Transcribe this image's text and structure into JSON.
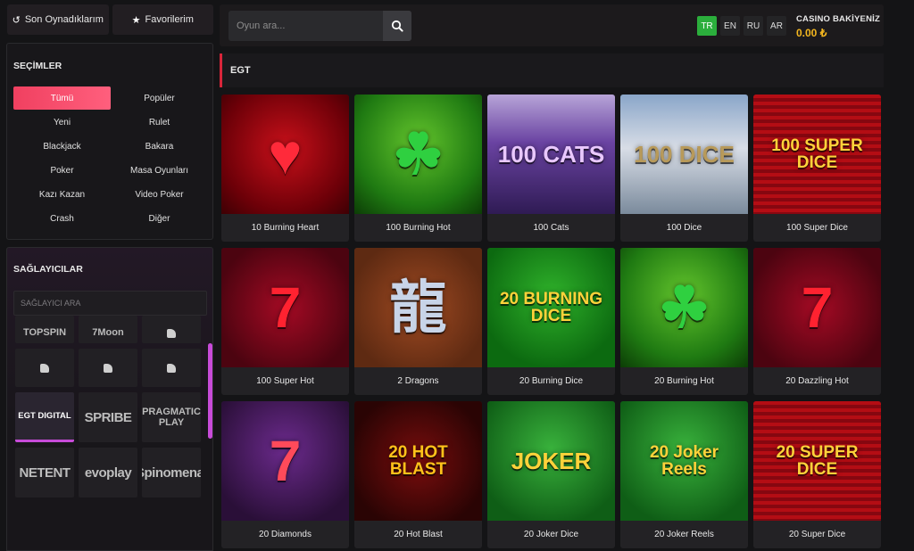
{
  "top_buttons": [
    {
      "label": "Son Oynadıklarım",
      "icon": "history-icon"
    },
    {
      "label": "Favorilerim",
      "icon": "star-icon"
    }
  ],
  "search": {
    "placeholder": "Oyun ara..."
  },
  "languages": [
    {
      "code": "TR",
      "active": true
    },
    {
      "code": "EN",
      "active": false
    },
    {
      "code": "RU",
      "active": false
    },
    {
      "code": "AR",
      "active": false
    }
  ],
  "balance": {
    "label": "CASINO BAKİYENİZ",
    "value": "0.00 ₺"
  },
  "choices": {
    "title": "SEÇİMLER",
    "items": [
      "Tümü",
      "Popüler",
      "Yeni",
      "Rulet",
      "Blackjack",
      "Bakara",
      "Poker",
      "Masa Oyunları",
      "Kazı Kazan",
      "Video Poker",
      "Crash",
      "Diğer"
    ],
    "active_index": 0
  },
  "providers": {
    "title": "SAĞLAYICILAR",
    "search_placeholder": "SAĞLAYICI ARA",
    "items": [
      {
        "name": "TOPSPIN"
      },
      {
        "name": "7Moon"
      },
      {
        "name": ""
      },
      {
        "name": ""
      },
      {
        "name": ""
      },
      {
        "name": ""
      },
      {
        "name": "EGT DIGITAL",
        "selected": true
      },
      {
        "name": "SPRIBE"
      },
      {
        "name": "PRAGMATIC PLAY"
      },
      {
        "name": "NETENT"
      },
      {
        "name": "evoplay"
      },
      {
        "name": "Spinomenal"
      }
    ]
  },
  "section": {
    "title": "EGT"
  },
  "games": [
    {
      "name": "10 Burning Heart",
      "art": "♥",
      "bg": "t-red",
      "artColor": "#ff2a3a"
    },
    {
      "name": "100 Burning Hot",
      "art": "☘",
      "bg": "t-green",
      "artColor": "#2fd040"
    },
    {
      "name": "100 Cats",
      "art": "100 CATS",
      "bg": "t-purple",
      "artColor": "#e9c8ff"
    },
    {
      "name": "100 Dice",
      "art": "100 DICE",
      "bg": "t-snow",
      "artColor": "#b89a5a"
    },
    {
      "name": "100 Super Dice",
      "art": "100 SUPER DICE",
      "bg": "t-redstripes",
      "artColor": "#ffd23a"
    },
    {
      "name": "100 Super Hot",
      "art": "7",
      "bg": "t-darkred",
      "artColor": "#ff2230"
    },
    {
      "name": "2 Dragons",
      "art": "龍",
      "bg": "t-brown",
      "artColor": "#c8d4e8"
    },
    {
      "name": "20 Burning Dice",
      "art": "20 BURNING DICE",
      "bg": "t-green2",
      "artColor": "#ffd23a"
    },
    {
      "name": "20 Burning Hot",
      "art": "☘",
      "bg": "t-green",
      "artColor": "#2fd040"
    },
    {
      "name": "20 Dazzling Hot",
      "art": "7",
      "bg": "t-darkred",
      "artColor": "#ff2230"
    },
    {
      "name": "20 Diamonds",
      "art": "7",
      "bg": "t-violet",
      "artColor": "#ff4a5a"
    },
    {
      "name": "20 Hot Blast",
      "art": "20 HOT BLAST",
      "bg": "t-hot",
      "artColor": "#ffc21a"
    },
    {
      "name": "20 Joker Dice",
      "art": "JOKER",
      "bg": "t-joker",
      "artColor": "#ffd23a"
    },
    {
      "name": "20 Joker Reels",
      "art": "20 Joker Reels",
      "bg": "t-joker",
      "artColor": "#ffd23a"
    },
    {
      "name": "20 Super Dice",
      "art": "20 SUPER DICE",
      "bg": "t-redstripes",
      "artColor": "#ffd23a"
    }
  ]
}
